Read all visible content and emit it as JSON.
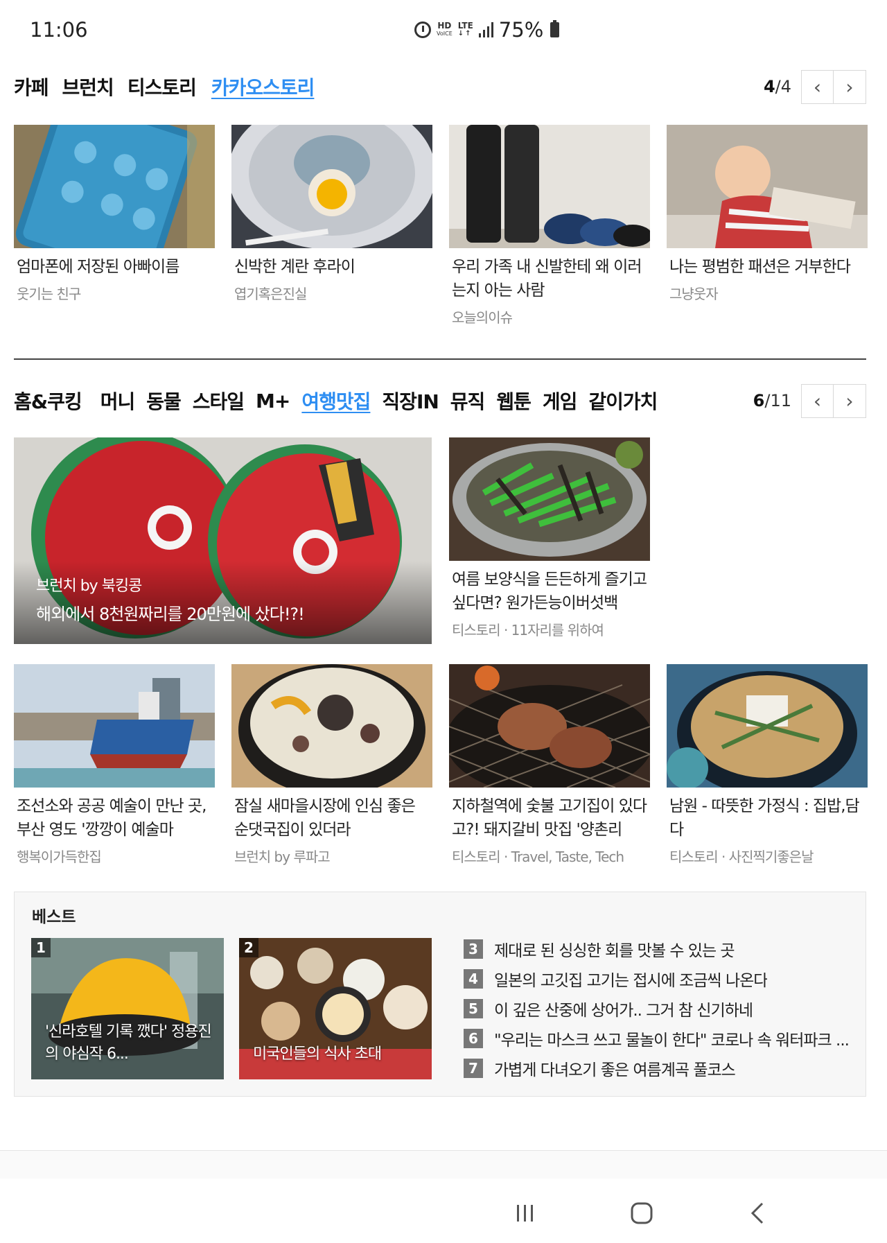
{
  "status_bar": {
    "time": "11:06",
    "battery": "75%",
    "hd": "HD",
    "voice": "VoICE",
    "lte": "LTE"
  },
  "section1": {
    "tabs": [
      {
        "label": "카페",
        "active": false
      },
      {
        "label": "브런치",
        "active": false
      },
      {
        "label": "티스토리",
        "active": false
      },
      {
        "label": "카카오스토리",
        "active": true
      }
    ],
    "pager": {
      "current": "4",
      "total": "/4"
    },
    "cards": [
      {
        "title": "엄마폰에 저장된 아빠이름",
        "source": "웃기는 친구"
      },
      {
        "title": "신박한 계란 후라이",
        "source": "엽기혹은진실"
      },
      {
        "title": "우리 가족 내 신발한테 왜 이러는지 아는 사람",
        "source": "오늘의이슈"
      },
      {
        "title": "나는 평범한 패션은 거부한다",
        "source": "그냥웃자"
      }
    ]
  },
  "section2": {
    "tabs": [
      {
        "label": "홈&쿠킹",
        "active": false
      },
      {
        "label": "머니",
        "active": false
      },
      {
        "label": "동물",
        "active": false
      },
      {
        "label": "스타일",
        "active": false
      },
      {
        "label": "M+",
        "active": false
      },
      {
        "label": "여행맛집",
        "active": true
      },
      {
        "label": "직장IN",
        "active": false
      },
      {
        "label": "뮤직",
        "active": false
      },
      {
        "label": "웹툰",
        "active": false
      },
      {
        "label": "게임",
        "active": false
      },
      {
        "label": "같이가치",
        "active": false
      }
    ],
    "pager": {
      "current": "6",
      "total": "/11"
    },
    "featured": {
      "source": "브런치 by 북킹콩",
      "title": "해외에서 8천원짜리를 20만원에 샀다!?!"
    },
    "side_card": {
      "title": "여름 보양식을 든든하게 즐기고 싶다면? 원가든능이버섯백",
      "source": "티스토리 · 11자리를 위하여"
    },
    "cards": [
      {
        "title": "조선소와 공공 예술이 만난 곳, 부산 영도 '깡깡이 예술마",
        "source": "행복이가득한집"
      },
      {
        "title": "잠실 새마을시장에 인심 좋은 순댓국집이 있더라",
        "source": "브런치 by 루파고"
      },
      {
        "title": "지하철역에 숯불 고기집이 있다고?! 돼지갈비 맛집 '양촌리",
        "source": "티스토리 · Travel, Taste, Tech"
      },
      {
        "title": "남원 - 따뜻한 가정식 : 집밥,담다",
        "source": "티스토리 · 사진찍기좋은날"
      }
    ]
  },
  "best": {
    "label": "베스트",
    "cards": [
      {
        "rank": "1",
        "title": "'신라호텔 기록 깼다' 정용진의 야심작 6..."
      },
      {
        "rank": "2",
        "title": "미국인들의 식사 초대"
      }
    ],
    "list": [
      {
        "rank": "3",
        "text": "제대로 된 싱싱한 회를 맛볼 수 있는 곳"
      },
      {
        "rank": "4",
        "text": "일본의 고깃집 고기는 접시에 조금씩 나온다"
      },
      {
        "rank": "5",
        "text": "이 깊은 산중에 상어가.. 그거 참 신기하네"
      },
      {
        "rank": "6",
        "text": "\"우리는 마스크 쓰고 물놀이 한다\" 코로나 속 워터파크 ..."
      },
      {
        "rank": "7",
        "text": "가볍게 다녀오기 좋은 여름계곡 풀코스"
      }
    ]
  },
  "nav": [
    "recent-apps-icon",
    "home-icon",
    "back-icon"
  ],
  "colors": {
    "accent": "#2e8ef2",
    "text": "#222222",
    "muted": "#888888"
  }
}
